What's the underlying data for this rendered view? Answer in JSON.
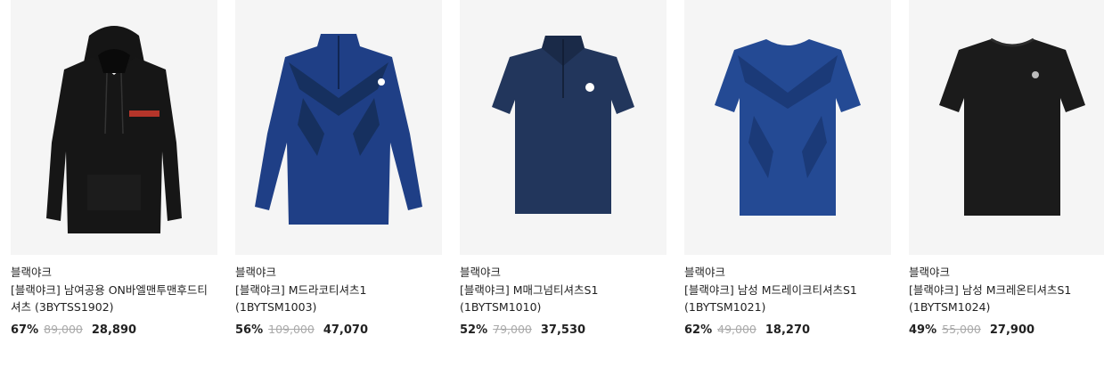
{
  "products": [
    {
      "brand": "블랙야크",
      "name": "[블랙야크] 남여공용 ON바엘맨투맨후드티셔츠 (3BYTSS1902)",
      "discount": "67%",
      "original_price": "89,000",
      "sale_price": "28,890",
      "garment": "hoodie-icon",
      "color": "#111111"
    },
    {
      "brand": "블랙야크",
      "name": "[블랙야크] M드라코티셔츠1 (1BYTSM1003)",
      "discount": "56%",
      "original_price": "109,000",
      "sale_price": "47,070",
      "garment": "long-sleeve-zip-icon",
      "color": "#1f3f86"
    },
    {
      "brand": "블랙야크",
      "name": "[블랙야크] M매그넘티셔츠S1 (1BYTSM1010)",
      "discount": "52%",
      "original_price": "79,000",
      "sale_price": "37,530",
      "garment": "polo-zip-icon",
      "color": "#22365c"
    },
    {
      "brand": "블랙야크",
      "name": "[블랙야크] 남성 M드레이크티셔츠S1 (1BYTSM1021)",
      "discount": "62%",
      "original_price": "49,000",
      "sale_price": "18,270",
      "garment": "tshirt-icon",
      "color": "#244a94"
    },
    {
      "brand": "블랙야크",
      "name": "[블랙야크] 남성 M크레온티셔츠S1 (1BYTSM1024)",
      "discount": "49%",
      "original_price": "55,000",
      "sale_price": "27,900",
      "garment": "tshirt-icon",
      "color": "#1b1b1b"
    }
  ]
}
